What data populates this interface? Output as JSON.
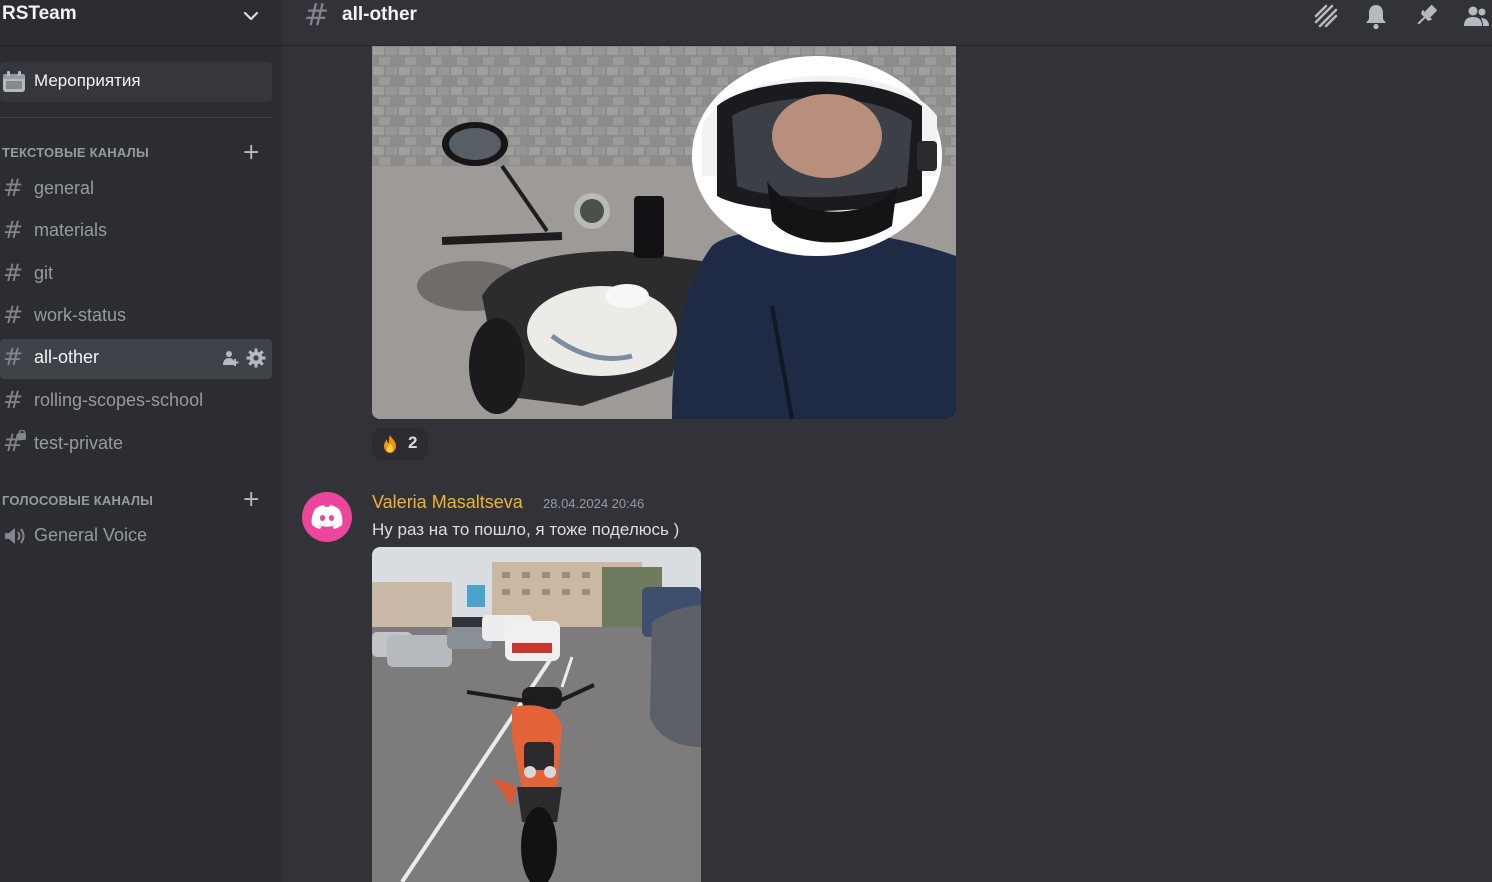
{
  "server": {
    "name": "RSTeam"
  },
  "sidebar": {
    "events_label": "Мероприятия",
    "text_category": "ТЕКСТОВЫЕ КАНАЛЫ",
    "voice_category": "ГОЛОСОВЫЕ КАНАЛЫ",
    "text_channels": [
      {
        "label": "general",
        "icon": "hash-icon"
      },
      {
        "label": "materials",
        "icon": "hash-icon"
      },
      {
        "label": "git",
        "icon": "hash-icon"
      },
      {
        "label": "work-status",
        "icon": "hash-icon"
      },
      {
        "label": "all-other",
        "icon": "hash-icon",
        "active": true
      },
      {
        "label": "rolling-scopes-school",
        "icon": "hash-icon"
      },
      {
        "label": "test-private",
        "icon": "hash-lock-icon"
      }
    ],
    "voice_channels": [
      {
        "label": "General Voice",
        "icon": "speaker-icon"
      }
    ],
    "hash_glyph": "#"
  },
  "header": {
    "channel_name": "all-other",
    "hash_glyph": "#",
    "icons": [
      "threads-icon",
      "bell-icon",
      "pin-icon",
      "members-icon"
    ]
  },
  "messages": [
    {
      "image": "selfie on motorcycle with helmet",
      "reaction": {
        "emoji": "fire-emoji",
        "count": "2"
      }
    },
    {
      "author": "Valeria Masaltseva",
      "timestamp": "28.04.2024 20:46",
      "text": "Ну раз на то пошло, я тоже поделюсь )",
      "avatar": "discord-logo-icon",
      "image": "orange motorcycle in parking lot"
    }
  ],
  "colors": {
    "sidebar_bg": "#2b2d31",
    "main_bg": "#313338",
    "author_color": "#f0b232",
    "avatar_bg": "#eb459e"
  }
}
